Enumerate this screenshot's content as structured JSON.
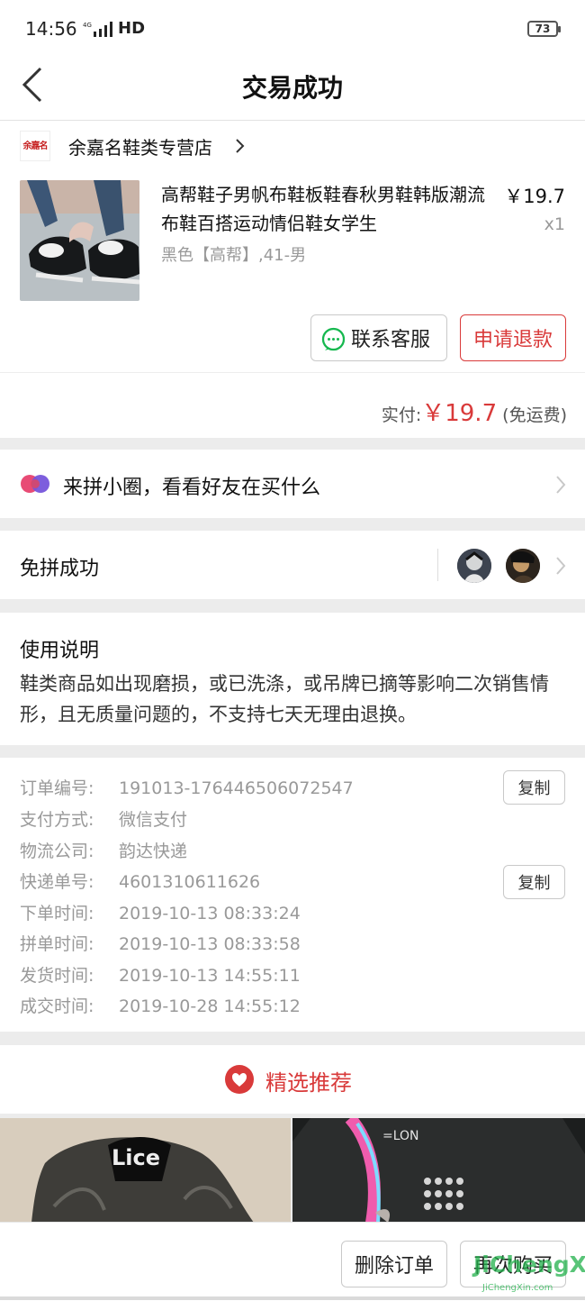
{
  "status_bar": {
    "time": "14:56",
    "network": "HD",
    "battery": "73"
  },
  "nav": {
    "title": "交易成功"
  },
  "shop": {
    "logo_text": "余嘉名",
    "name": "余嘉名鞋类专营店",
    "product": {
      "title": "高帮鞋子男帆布鞋板鞋春秋男鞋韩版潮流布鞋百搭运动情侣鞋女学生",
      "price": "￥19.7",
      "quantity": "x1",
      "spec": "黑色【高帮】,41-男"
    },
    "buttons": {
      "contact_service": "联系客服",
      "request_refund": "申请退款"
    },
    "payment": {
      "label": "实付:",
      "amount": "￥19.7",
      "note": "(免运费)"
    }
  },
  "circle_row": {
    "text": "来拼小圈，看看好友在买什么"
  },
  "group_row": {
    "text": "免拼成功"
  },
  "usage_notes": {
    "title": "使用说明",
    "body": "鞋类商品如出现磨损，或已洗涤，或吊牌已摘等影响二次销售情形，且无质量问题的，不支持七天无理由退换。"
  },
  "order_info": {
    "copy_label": "复制",
    "rows": [
      {
        "label": "订单编号:",
        "value": "191013-176446506072547"
      },
      {
        "label": "支付方式:",
        "value": "微信支付"
      },
      {
        "label": "物流公司:",
        "value": "韵达快递"
      },
      {
        "label": "快递单号:",
        "value": "4601310611626"
      },
      {
        "label": "下单时间:",
        "value": "2019-10-13 08:33:24"
      },
      {
        "label": "拼单时间:",
        "value": "2019-10-13 08:33:58"
      },
      {
        "label": "发货时间:",
        "value": "2019-10-13 14:55:11"
      },
      {
        "label": "成交时间:",
        "value": "2019-10-28 14:55:12"
      }
    ]
  },
  "recommend": {
    "title": "精选推荐",
    "image_1_text": "Lice"
  },
  "bottom_bar": {
    "delete_order": "删除订单",
    "buy_again": "再次购买"
  },
  "watermark": {
    "top": "JiChengXin",
    "bottom": "JiChengXin.com"
  },
  "colors": {
    "accent": "#d93a3a",
    "wechat": "#16b84f",
    "background": "#ececec"
  }
}
